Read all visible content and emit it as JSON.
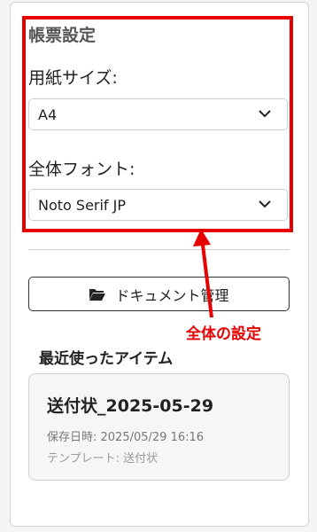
{
  "settings": {
    "section_title": "帳票設定",
    "paper_size_label": "用紙サイズ:",
    "paper_size_value": "A4",
    "font_label": "全体フォント:",
    "font_value": "Noto Serif JP"
  },
  "doc_button": {
    "label": "ドキュメント管理",
    "icon": "folder-open-icon"
  },
  "annotation": {
    "label": "全体の設定",
    "color": "#e60000"
  },
  "recent": {
    "title": "最近使ったアイテム",
    "items": [
      {
        "name": "送付状_2025-05-29",
        "saved": "保存日時: 2025/05/29 16:16",
        "template": "テンプレート: 送付状"
      }
    ]
  }
}
